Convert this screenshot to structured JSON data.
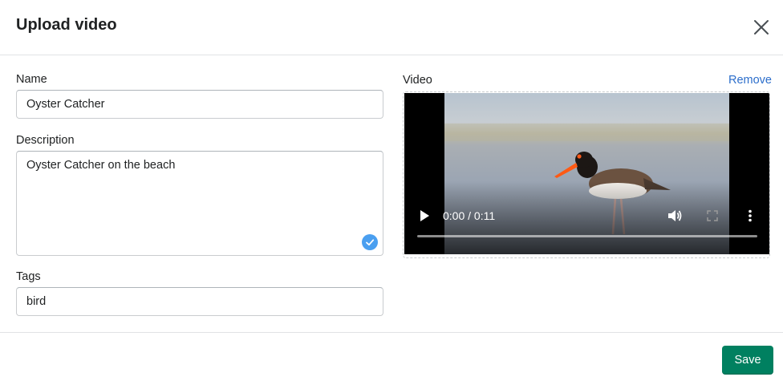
{
  "modal": {
    "title": "Upload video",
    "close_icon": "close-icon"
  },
  "form": {
    "name": {
      "label": "Name",
      "value": "Oyster Catcher"
    },
    "description": {
      "label": "Description",
      "value": "Oyster Catcher on the beach",
      "status_icon": "checkmark-icon"
    },
    "tags": {
      "label": "Tags",
      "value": "bird"
    }
  },
  "video": {
    "label": "Video",
    "remove_label": "Remove",
    "player": {
      "time": "0:00 / 0:11",
      "progress": 0,
      "icons": [
        "play-icon",
        "volume-icon",
        "fullscreen-icon",
        "more-options-icon"
      ]
    }
  },
  "footer": {
    "save_label": "Save"
  },
  "colors": {
    "primary": "#008060",
    "link": "#2c6ecb",
    "check": "#4a9ff0",
    "border": "#c9cccf"
  }
}
